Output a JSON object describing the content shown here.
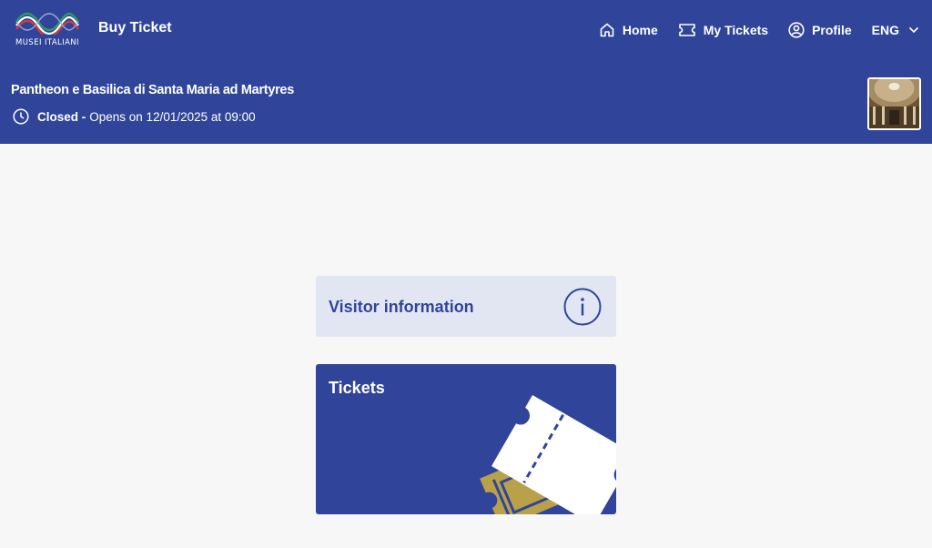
{
  "header": {
    "logo_text": "MUSEI ITALIANI",
    "app_title": "Buy Ticket",
    "nav": {
      "home": "Home",
      "my_tickets": "My Tickets",
      "profile": "Profile",
      "language": "ENG"
    }
  },
  "site": {
    "title": "Pantheon e Basilica di Santa Maria ad Martyres",
    "status": "Closed -",
    "opens": "Opens on 12/01/2025 at 09:00"
  },
  "cards": {
    "visitor_info": "Visitor information",
    "tickets": "Tickets"
  },
  "colors": {
    "brand_blue": "#304599",
    "info_card_bg": "#e2e6f3",
    "gold": "#b9a14a",
    "page_bg": "#f7f7f7"
  },
  "icons": {
    "logo": "musei-italiani-logo",
    "home": "home-icon",
    "tickets": "ticket-icon",
    "profile": "user-circle-icon",
    "language": "chevron-down-icon",
    "clock": "clock-icon",
    "info": "info-icon"
  }
}
